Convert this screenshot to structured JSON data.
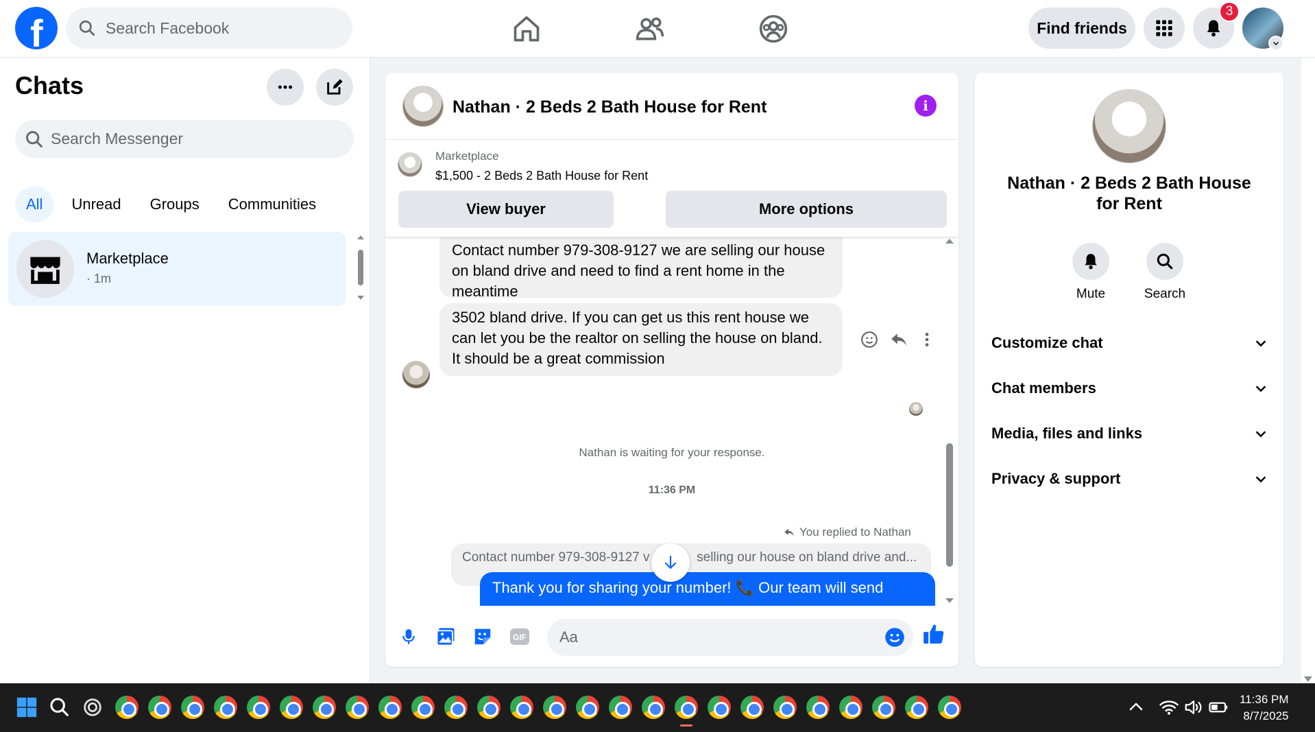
{
  "topbar": {
    "search_placeholder": "Search Facebook",
    "find_friends": "Find friends",
    "notification_count": "3"
  },
  "left": {
    "title": "Chats",
    "search_placeholder": "Search Messenger",
    "filters": [
      "All",
      "Unread",
      "Groups",
      "Communities"
    ],
    "active_filter": "All",
    "chat": {
      "name": "Marketplace",
      "sub": "· 1m"
    }
  },
  "conversation": {
    "title": "Nathan · 2 Beds 2 Bath House for Rent",
    "marketplace_label": "Marketplace",
    "listing": "$1,500 - 2 Beds 2 Bath House for Rent",
    "view_buyer": "View buyer",
    "more_options": "More options",
    "messages": [
      "Contact number 979-308-9127 we are selling our house on bland drive  and need to find a rent home in the meantime",
      "3502 bland drive. If you can get us this rent house we can let you be the realtor on selling the house on bland. It should be a great commission"
    ],
    "waiting_note": "Nathan is waiting for your response.",
    "time": "11:36 PM",
    "replied_label": "You replied to Nathan",
    "quoted_text": "Contact number 979-308-9127 we are selling our house on bland drive  and...",
    "quoted_visible_left": "Contact number 979-308-9127 v",
    "quoted_visible_right": "selling our house on bland drive  and...",
    "reply_text": "Thank you for sharing your number! 📞 Our team will send",
    "composer_placeholder": "Aa"
  },
  "details": {
    "name": "Nathan · 2 Beds 2 Bath House for Rent",
    "actions": [
      "Mute",
      "Search"
    ],
    "sections": [
      "Customize chat",
      "Chat members",
      "Media, files and links",
      "Privacy & support"
    ]
  },
  "taskbar": {
    "time": "11:36 PM",
    "date": "8/7/2025"
  },
  "colors": {
    "brand": "#0866ff",
    "badge": "#e41e3f",
    "info": "#a020f0"
  }
}
